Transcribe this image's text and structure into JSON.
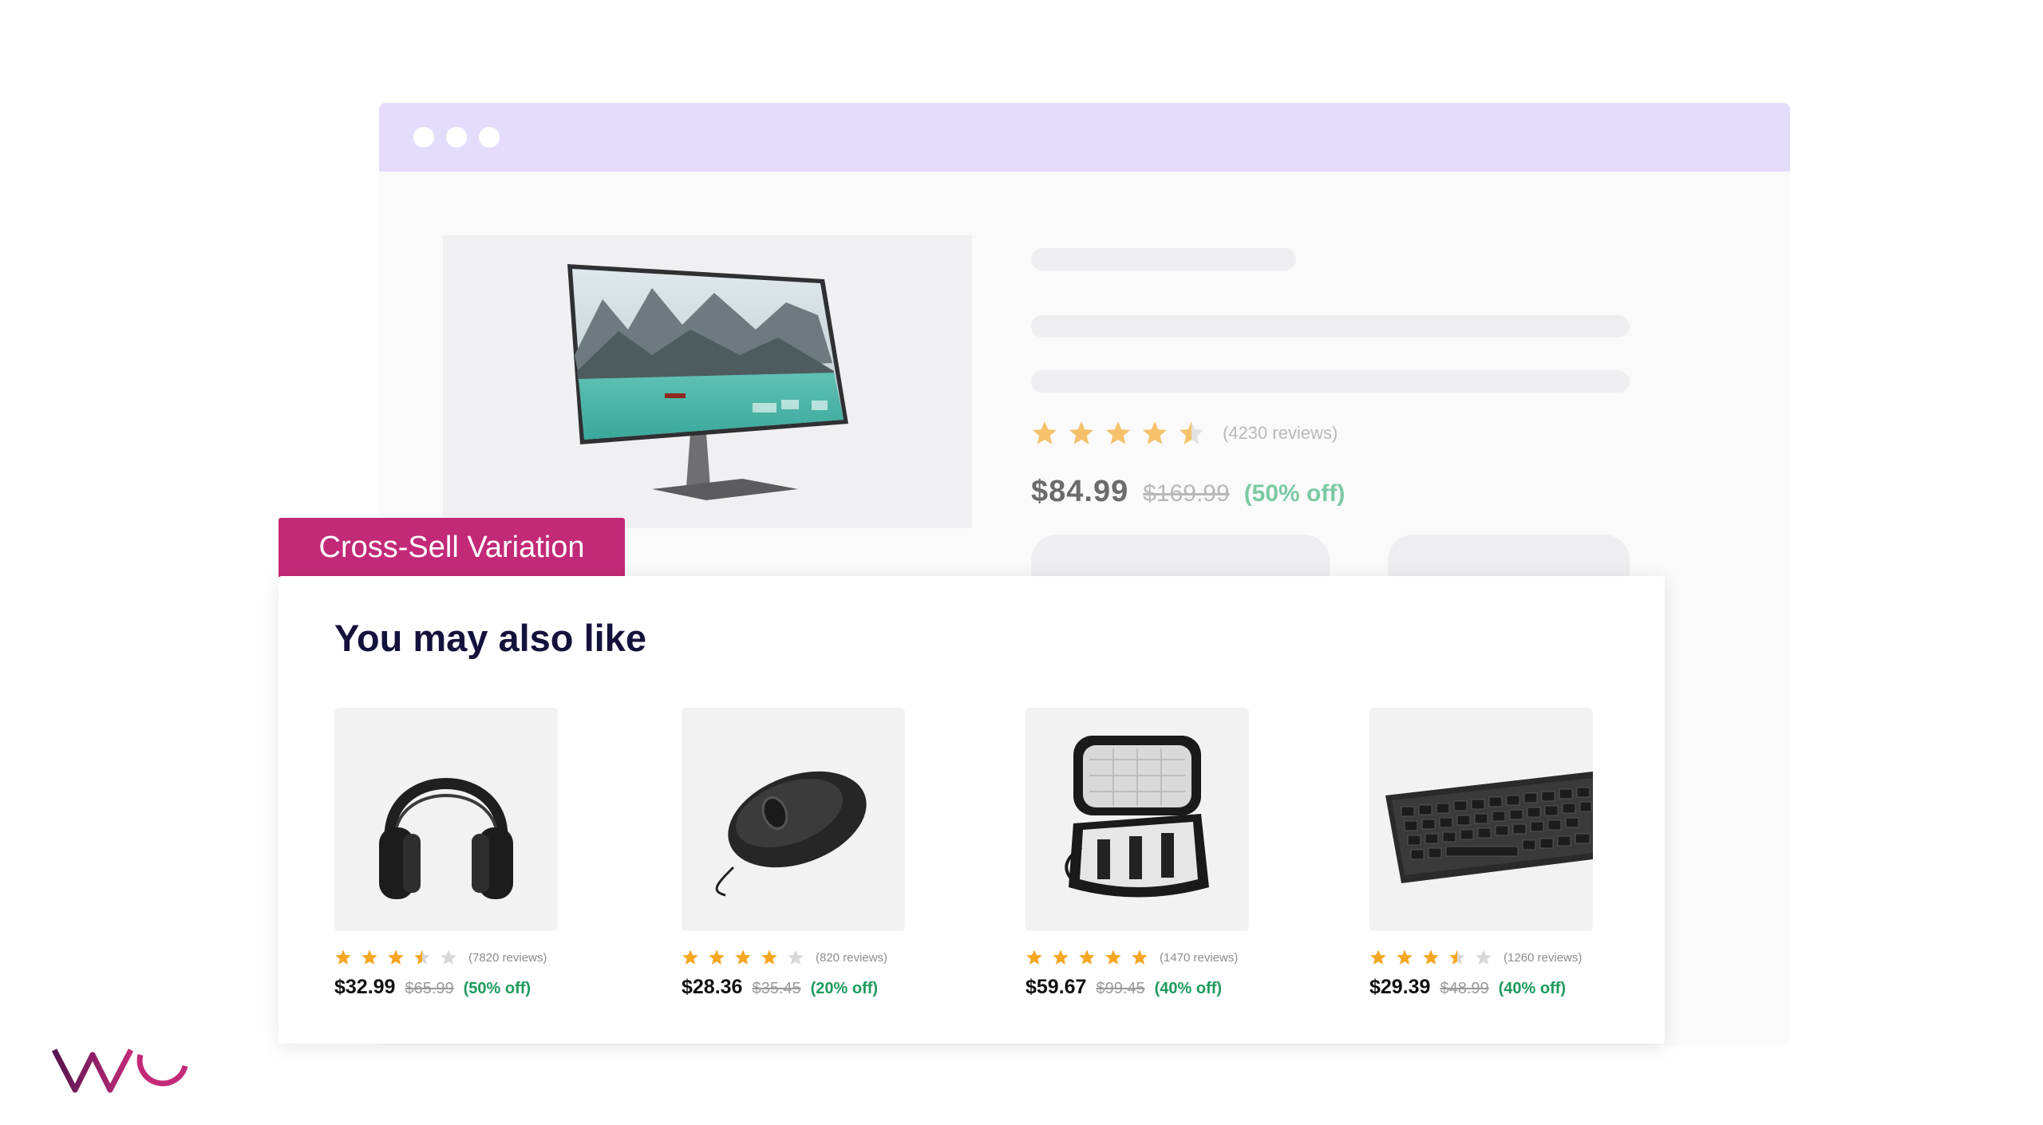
{
  "colors": {
    "browser_bar": "#e5dcfb",
    "tag_bg": "#c22a78",
    "star": "#f5a623",
    "star_empty": "#d8d8d8",
    "discount": "#1c9b5e",
    "logo": "#56154f"
  },
  "hero": {
    "rating": 4.5,
    "reviews": "(4230 reviews)",
    "price": "$84.99",
    "old_price": "$169.99",
    "discount": "(50% off)"
  },
  "variation_tag": "Cross-Sell Variation",
  "cross_sell": {
    "title": "You may also like",
    "products": [
      {
        "image_icon": "headphones-icon",
        "rating": 3.5,
        "reviews": "(7820 reviews)",
        "price": "$32.99",
        "old_price": "$65.99",
        "discount": "(50% off)"
      },
      {
        "image_icon": "mouse-icon",
        "rating": 4,
        "reviews": "(820 reviews)",
        "price": "$28.36",
        "old_price": "$35.45",
        "discount": "(20% off)"
      },
      {
        "image_icon": "storage-case-icon",
        "rating": 5,
        "reviews": "(1470 reviews)",
        "price": "$59.67",
        "old_price": "$99.45",
        "discount": "(40% off)"
      },
      {
        "image_icon": "keyboard-icon",
        "rating": 3.5,
        "reviews": "(1260 reviews)",
        "price": "$29.39",
        "old_price": "$48.99",
        "discount": "(40% off)"
      }
    ]
  },
  "logo": {
    "icon": "vwo-logo-icon"
  }
}
